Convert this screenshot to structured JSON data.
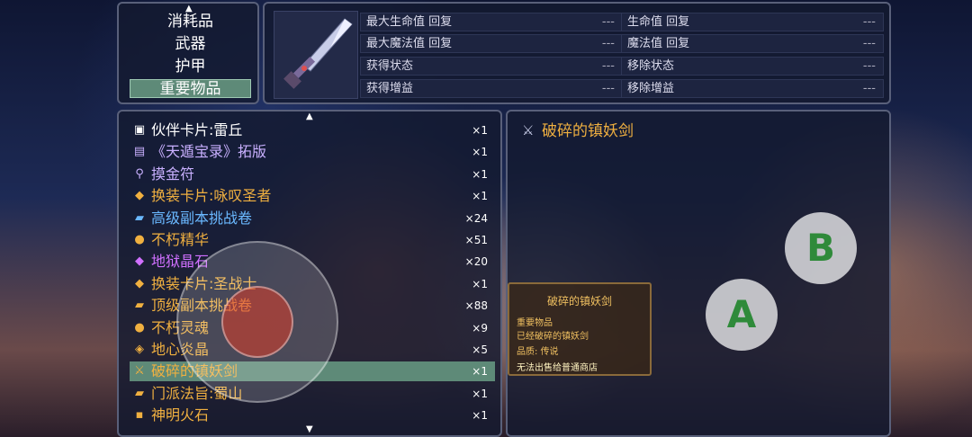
{
  "categories": [
    {
      "label": "消耗品",
      "selected": false
    },
    {
      "label": "武器",
      "selected": false
    },
    {
      "label": "护甲",
      "selected": false
    },
    {
      "label": "重要物品",
      "selected": true
    }
  ],
  "stats": {
    "left": [
      {
        "label": "最大生命值 回复",
        "value": "---"
      },
      {
        "label": "最大魔法值 回复",
        "value": "---"
      },
      {
        "label": "获得状态",
        "value": "---"
      },
      {
        "label": "获得增益",
        "value": "---"
      }
    ],
    "right": [
      {
        "label": "生命值 回复",
        "value": "---"
      },
      {
        "label": "魔法值 回复",
        "value": "---"
      },
      {
        "label": "移除状态",
        "value": "---"
      },
      {
        "label": "移除增益",
        "value": "---"
      }
    ]
  },
  "items": [
    {
      "icon": "card-icon",
      "glyph": "▣",
      "name": "伙伴卡片:雷丘",
      "qty": "×1",
      "color": "#ffffff",
      "selected": false
    },
    {
      "icon": "book-icon",
      "glyph": "▤",
      "name": "《天遁宝录》拓版",
      "qty": "×1",
      "color": "#c9b0ff",
      "selected": false
    },
    {
      "icon": "magnifier-icon",
      "glyph": "⚲",
      "name": "摸金符",
      "qty": "×1",
      "color": "#c9b0ff",
      "selected": false
    },
    {
      "icon": "ticket-icon",
      "glyph": "◆",
      "name": "换装卡片:咏叹圣者",
      "qty": "×1",
      "color": "#f0b040",
      "selected": false
    },
    {
      "icon": "scroll-icon",
      "glyph": "▰",
      "name": "高级副本挑战卷",
      "qty": "×24",
      "color": "#6ab8ff",
      "selected": false
    },
    {
      "icon": "orb-icon",
      "glyph": "●",
      "name": "不朽精华",
      "qty": "×51",
      "color": "#f0b040",
      "selected": false
    },
    {
      "icon": "crystal-icon",
      "glyph": "◆",
      "name": "地狱晶石",
      "qty": "×20",
      "color": "#d070ff",
      "selected": false
    },
    {
      "icon": "ticket-icon",
      "glyph": "◆",
      "name": "换装卡片:圣战士",
      "qty": "×1",
      "color": "#f0b040",
      "selected": false
    },
    {
      "icon": "scroll-icon",
      "glyph": "▰",
      "name": "顶级副本挑战卷",
      "qty": "×88",
      "color": "#f0b040",
      "selected": false
    },
    {
      "icon": "orb-icon",
      "glyph": "●",
      "name": "不朽灵魂",
      "qty": "×9",
      "color": "#f0b040",
      "selected": false
    },
    {
      "icon": "ore-icon",
      "glyph": "◈",
      "name": "地心炎晶",
      "qty": "×5",
      "color": "#f0b040",
      "selected": false
    },
    {
      "icon": "sword-icon",
      "glyph": "⚔",
      "name": "破碎的镇妖剑",
      "qty": "×1",
      "color": "#f0b040",
      "selected": true
    },
    {
      "icon": "scroll-icon",
      "glyph": "▰",
      "name": "门派法旨:蜀山",
      "qty": "×1",
      "color": "#f0b040",
      "selected": false
    },
    {
      "icon": "stone-icon",
      "glyph": "▪",
      "name": "神明火石",
      "qty": "×1",
      "color": "#f0b040",
      "selected": false
    }
  ],
  "detail": {
    "icon": "sword-icon",
    "title": "破碎的镇妖剑"
  },
  "tooltip": {
    "title": "破碎的镇妖剑",
    "category": "重要物品",
    "note": "已经破碎的镇妖剑",
    "quality": "品质: 传说",
    "restriction": "无法出售给普通商店"
  },
  "buttons": {
    "a_label": "A",
    "b_label": "B"
  },
  "colors": {
    "selected_bg": "#5e8a78",
    "legend_gold": "#f0b040",
    "rare_blue": "#6ab8ff",
    "epic_purple": "#d070ff",
    "button_green": "#2f8a3a"
  }
}
